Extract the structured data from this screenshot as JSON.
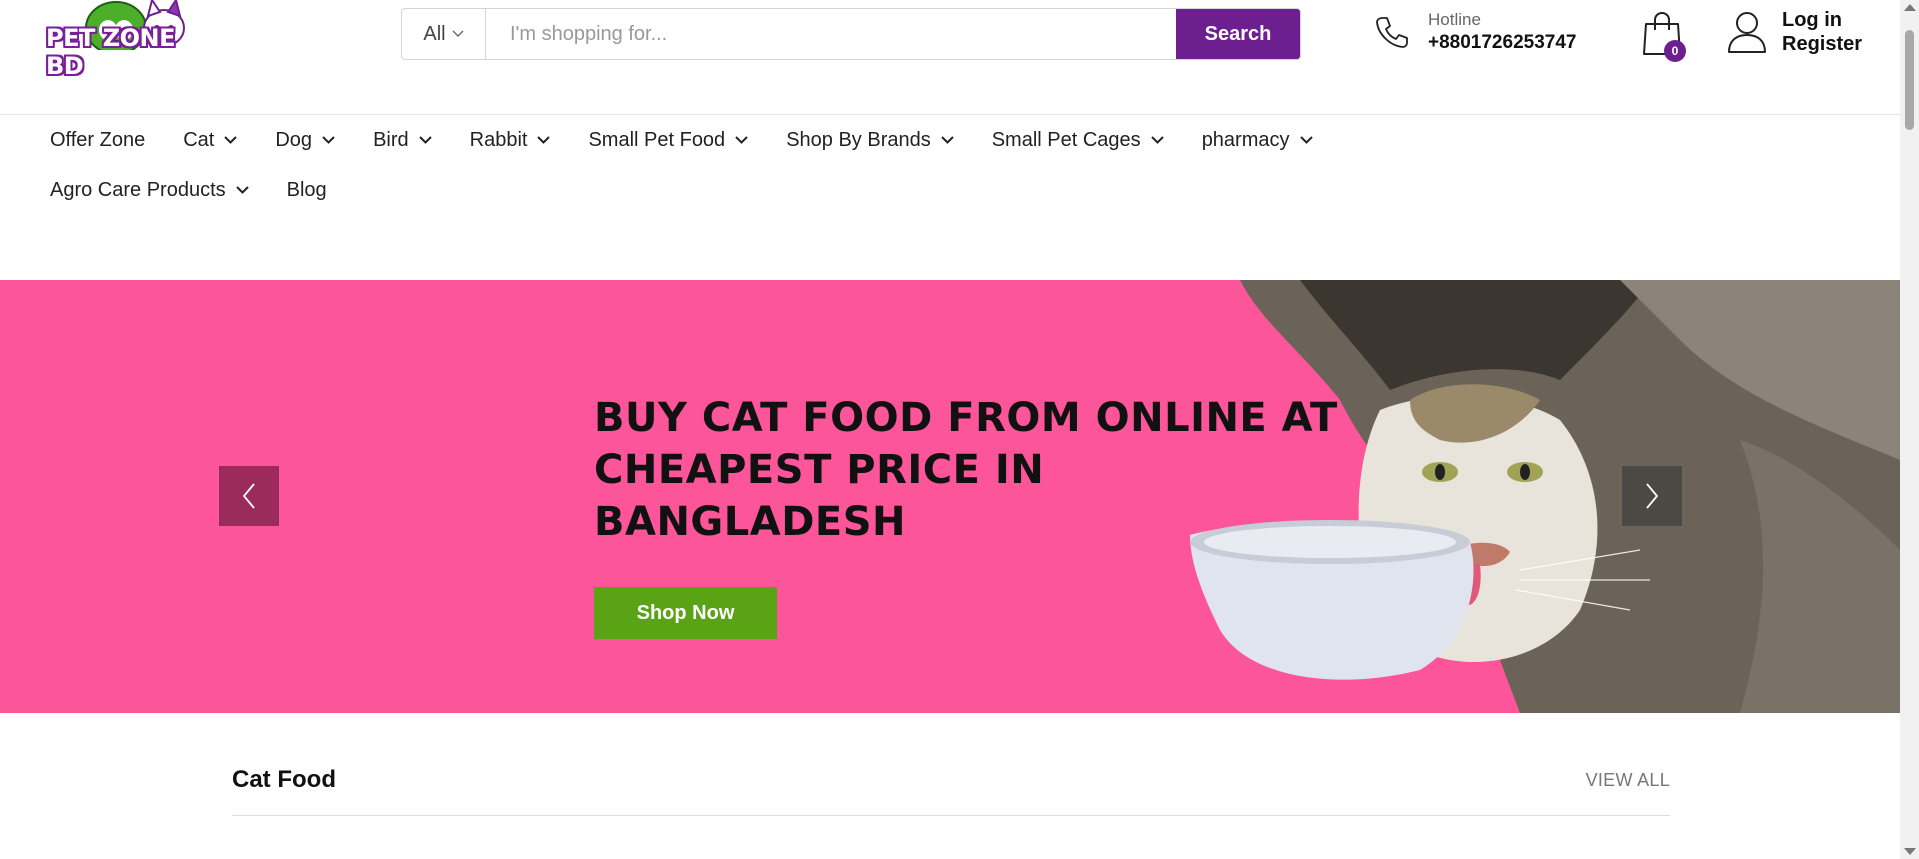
{
  "brand": {
    "logo_text": "PET ZONE BD",
    "primary_color": "#6e1f8f",
    "accent_green": "#5aa315",
    "hero_bg": "#fd5599"
  },
  "search": {
    "category": "All",
    "placeholder": "I'm shopping for...",
    "button_label": "Search"
  },
  "hotline": {
    "label": "Hotline",
    "number": "+8801726253747",
    "icon": "phone-icon"
  },
  "cart": {
    "count": "0",
    "icon": "shopping-bag-icon"
  },
  "account": {
    "login": "Log in",
    "register": "Register",
    "icon": "user-icon"
  },
  "nav": {
    "row1": [
      {
        "label": "Offer Zone",
        "dropdown": false
      },
      {
        "label": "Cat",
        "dropdown": true
      },
      {
        "label": "Dog",
        "dropdown": true
      },
      {
        "label": "Bird",
        "dropdown": true
      },
      {
        "label": "Rabbit",
        "dropdown": true
      },
      {
        "label": "Small Pet Food",
        "dropdown": true
      },
      {
        "label": "Shop By Brands",
        "dropdown": true
      },
      {
        "label": "Small Pet Cages",
        "dropdown": true
      },
      {
        "label": "pharmacy",
        "dropdown": true
      }
    ],
    "row2": [
      {
        "label": "Agro Care Products",
        "dropdown": true
      },
      {
        "label": "Blog",
        "dropdown": false
      }
    ]
  },
  "hero": {
    "title": "BUY CAT FOOD FROM ONLINE AT CHEAPEST PRICE IN BANGLADESH",
    "cta": "Shop Now"
  },
  "section": {
    "title": "Cat Food",
    "view_all": "VIEW ALL"
  }
}
